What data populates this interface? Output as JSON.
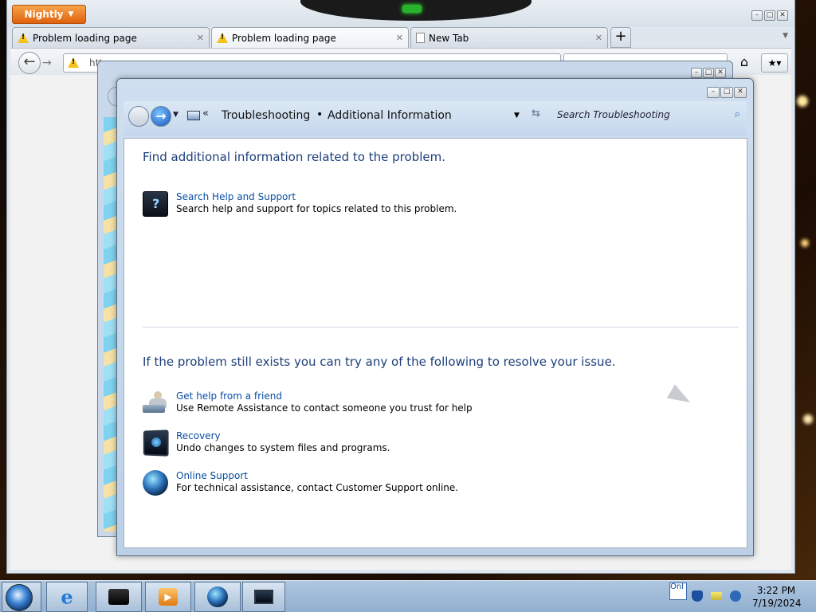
{
  "browser": {
    "app_button": "Nightly",
    "tabs": [
      {
        "label": "Problem loading page",
        "active": false
      },
      {
        "label": "Problem loading page",
        "active": true
      },
      {
        "label": "New Tab",
        "active": false
      }
    ],
    "url_partial": "htt"
  },
  "dialog": {
    "breadcrumb": [
      "Troubleshooting",
      "Additional Information"
    ],
    "search_placeholder": "Search Troubleshooting",
    "heading_1": "Find additional information related to the problem.",
    "heading_2": "If the problem still exists you can try any of the following to resolve your issue.",
    "items_top": [
      {
        "icon": "help-support-icon",
        "title": "Search Help and Support",
        "desc": "Search help and support for topics related to this problem."
      }
    ],
    "items_bottom": [
      {
        "icon": "remote-assistance-icon",
        "title": "Get help from a friend",
        "desc": "Use Remote Assistance to contact someone you trust for help"
      },
      {
        "icon": "recovery-icon",
        "title": "Recovery",
        "desc": "Undo changes to system files and programs."
      },
      {
        "icon": "online-support-icon",
        "title": "Online Support",
        "desc": "For technical assistance, contact Customer Support online."
      }
    ]
  },
  "taskbar": {
    "tray_online_label": "Onl",
    "time": "3:22 PM",
    "date": "7/19/2024"
  }
}
